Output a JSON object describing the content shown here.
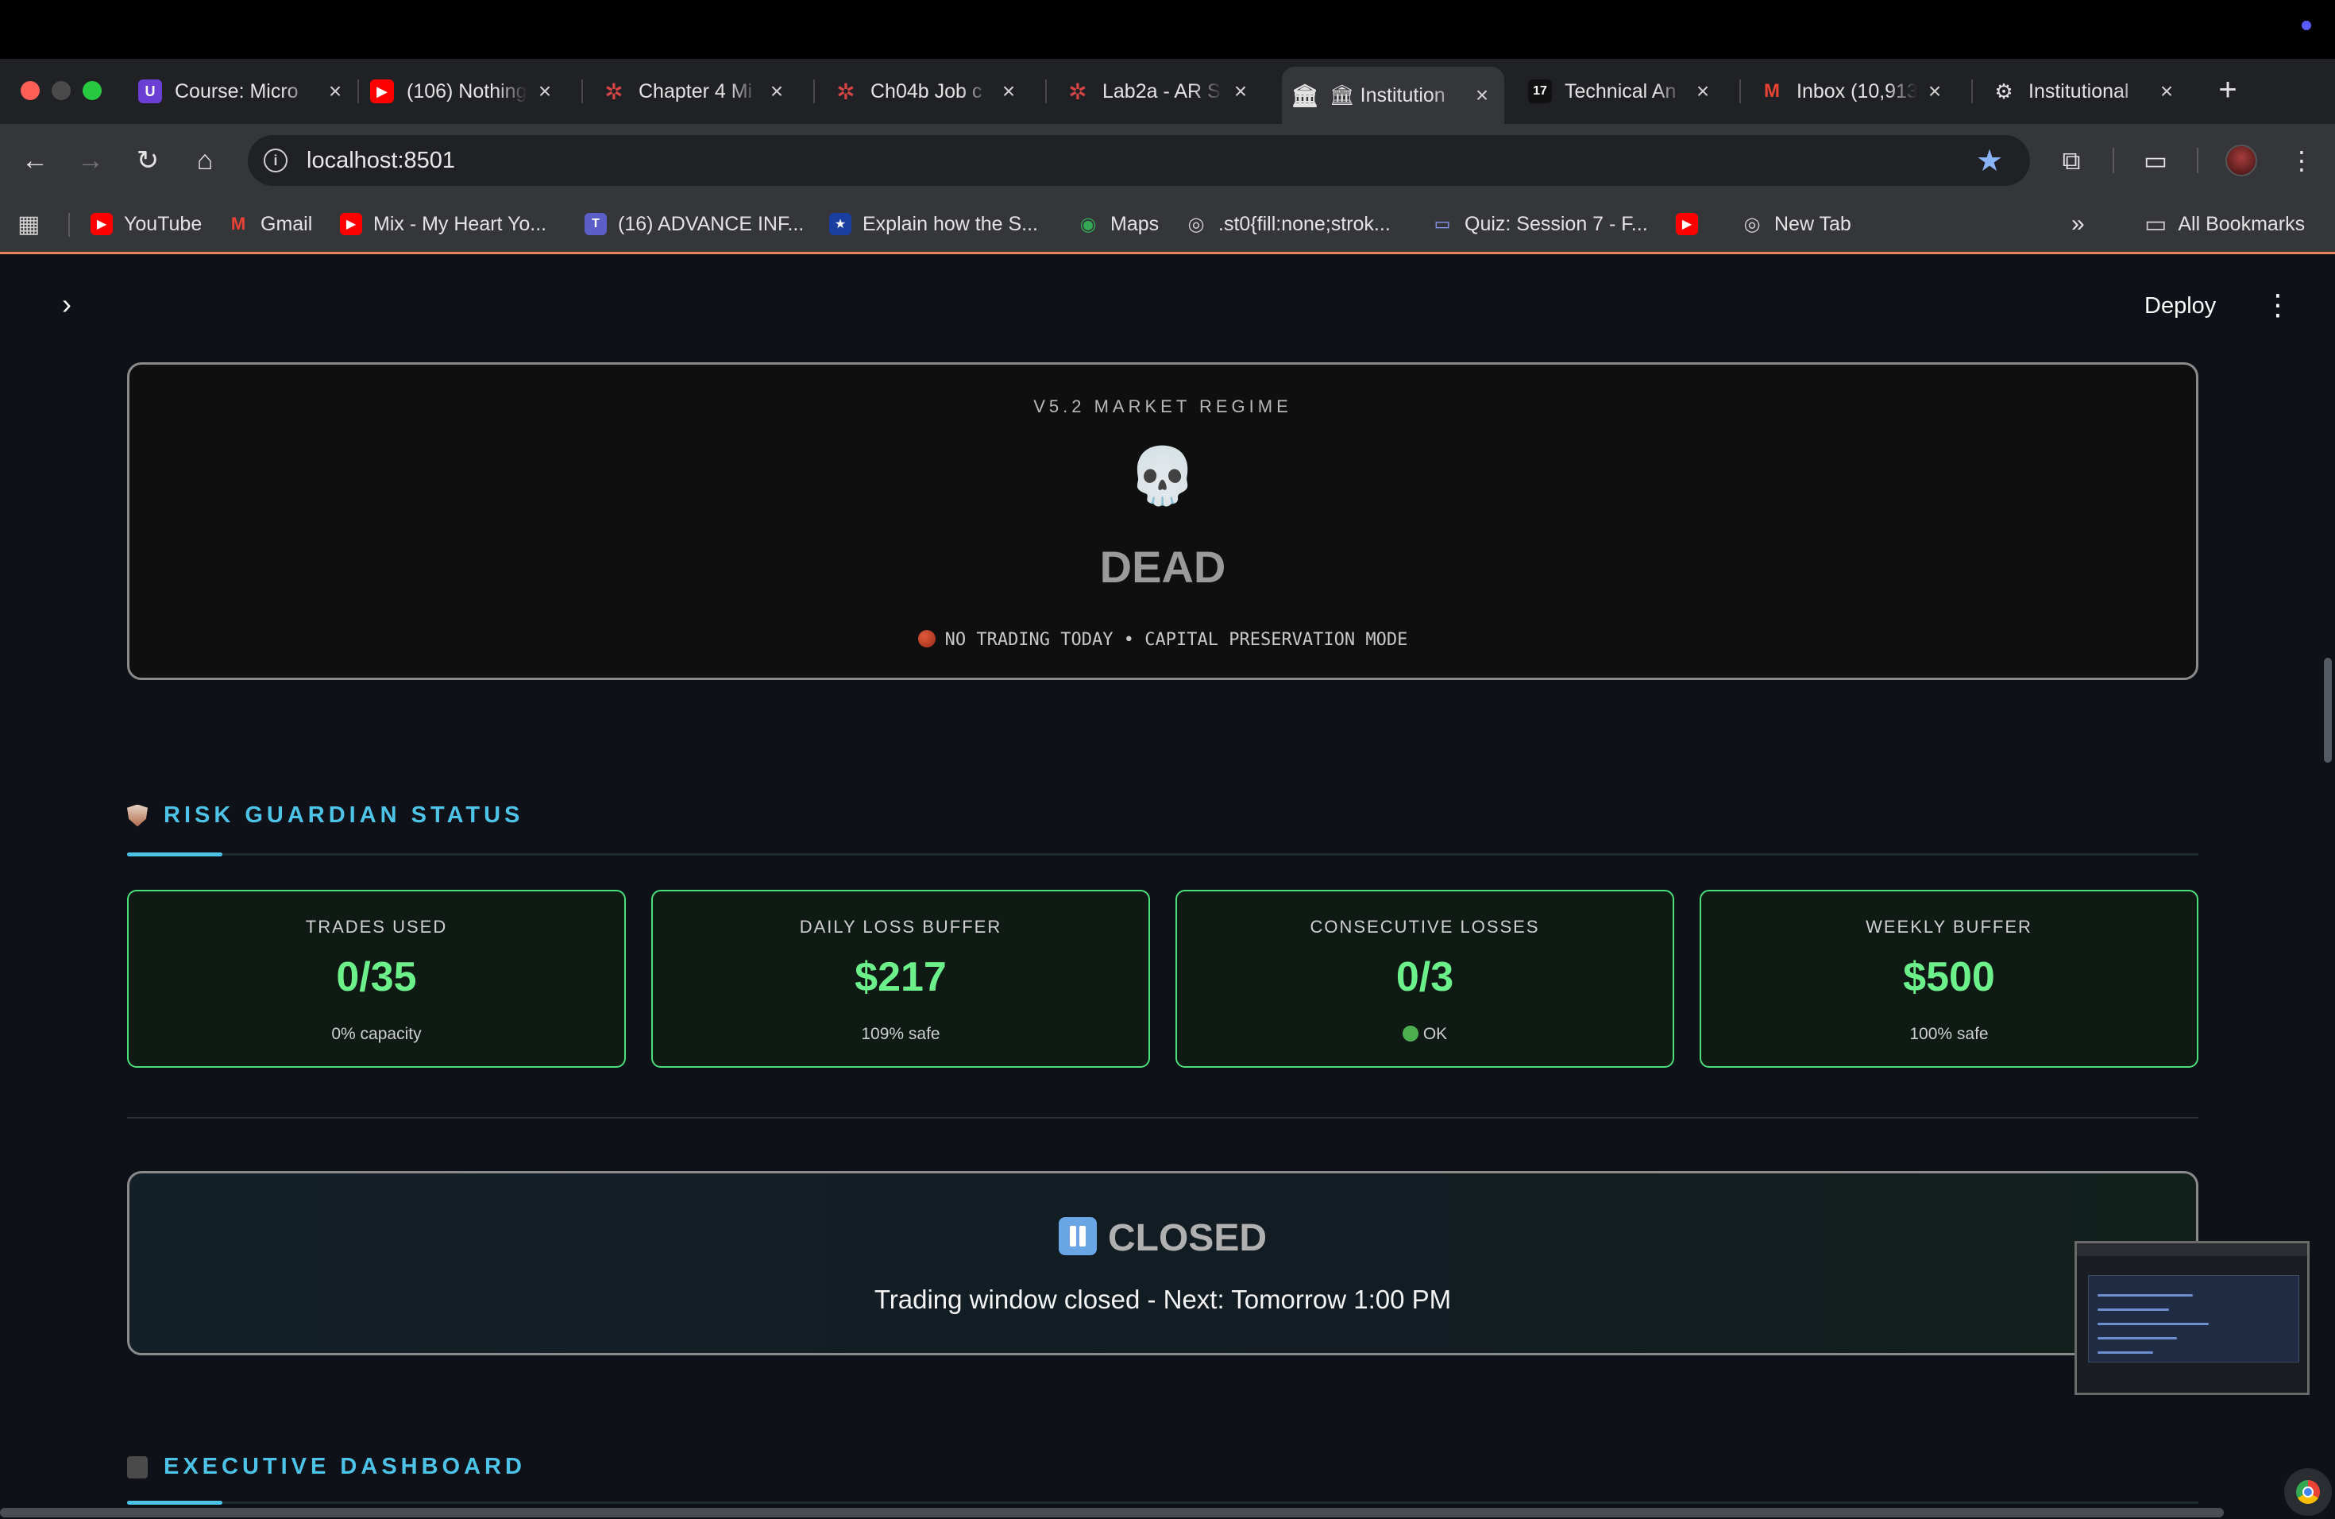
{
  "browser": {
    "tabs": [
      {
        "title": "Course: Micro",
        "favicon": "U",
        "color": "#6b3fd4"
      },
      {
        "title": "(106) Nothing",
        "favicon": "▶",
        "color": "#ff0000"
      },
      {
        "title": "Chapter 4 Mi",
        "favicon": "✲",
        "color": "#c0392b"
      },
      {
        "title": "Ch04b Job c",
        "favicon": "✲",
        "color": "#c0392b"
      },
      {
        "title": "Lab2a - AR S",
        "favicon": "✲",
        "color": "#c0392b"
      },
      {
        "title": "🏛 Institution",
        "favicon": "🏛",
        "color": "#35363a"
      },
      {
        "title": "Technical An",
        "favicon": "17",
        "color": "#111111"
      },
      {
        "title": "Inbox (10,913",
        "favicon": "M",
        "color": "#ea4335"
      },
      {
        "title": "Institutional",
        "favicon": "⚙",
        "color": "#35363a"
      }
    ],
    "new_tab_label": "+",
    "url": "localhost:8501",
    "bookmarks": [
      {
        "label": "YouTube",
        "favicon": "▶",
        "color": "#ff0000"
      },
      {
        "label": "Gmail",
        "favicon": "M",
        "color": "#ea4335"
      },
      {
        "label": "Mix - My Heart Yo...",
        "favicon": "▶",
        "color": "#ff0000"
      },
      {
        "label": "(16) ADVANCE INF...",
        "favicon": "T",
        "color": "#5b5fc7"
      },
      {
        "label": "Explain how the S...",
        "favicon": "★",
        "color": "#1a3fa0"
      },
      {
        "label": "Maps",
        "favicon": "◉",
        "color": "#34a853"
      },
      {
        "label": ".st0{fill:none;strok...",
        "favicon": "◎",
        "color": "#5f6368"
      },
      {
        "label": "Quiz: Session 7 - F...",
        "favicon": "▭",
        "color": "#3f51b5"
      },
      {
        "label": "",
        "favicon": "▶",
        "color": "#ff0000"
      },
      {
        "label": "New Tab",
        "favicon": "◎",
        "color": "#5f6368"
      }
    ],
    "overflow_label": "»",
    "all_bookmarks_label": "All Bookmarks"
  },
  "app": {
    "deploy_label": "Deploy",
    "regime": {
      "label": "V5.2 MARKET REGIME",
      "emoji": "💀",
      "state": "DEAD",
      "note": "NO TRADING TODAY • CAPITAL PRESERVATION MODE"
    },
    "risk": {
      "title": "RISK GUARDIAN STATUS",
      "metrics": [
        {
          "label": "TRADES USED",
          "value": "0/35",
          "sub": "0% capacity"
        },
        {
          "label": "DAILY LOSS BUFFER",
          "value": "$217",
          "sub": "109% safe"
        },
        {
          "label": "CONSECUTIVE LOSSES",
          "value": "0/3",
          "sub": "OK"
        },
        {
          "label": "WEEKLY BUFFER",
          "value": "$500",
          "sub": "100% safe"
        }
      ]
    },
    "window_status": {
      "title": "CLOSED",
      "message": "Trading window closed - Next: Tomorrow 1:00 PM"
    },
    "executive": {
      "title": "EXECUTIVE DASHBOARD"
    }
  },
  "colors": {
    "accent": "#4dc3e8",
    "metric_border": "#4ae07a",
    "metric_value": "#6cf08a",
    "background": "#0e1117"
  }
}
